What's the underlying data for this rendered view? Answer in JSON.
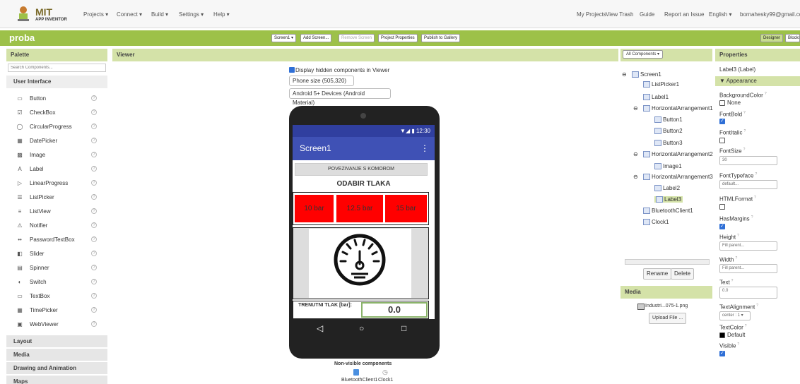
{
  "topnav": {
    "logo_main": "MIT",
    "logo_sub": "APP INVENTOR",
    "menus": [
      "Projects ▾",
      "Connect ▾",
      "Build ▾",
      "Settings ▾",
      "Help ▾"
    ],
    "right": [
      "My Projects",
      "View Trash",
      "Guide",
      "Report an Issue",
      "English ▾",
      "bornahesky99@gmail.com"
    ]
  },
  "projbar": {
    "project_name": "proba",
    "buttons": [
      "Screen1 ▾",
      "Add Screen...",
      "Remove Screen",
      "Project Properties",
      "Publish to Gallery"
    ],
    "designer": "Designer",
    "blocks": "Blocks"
  },
  "palette": {
    "title": "Palette",
    "search_placeholder": "Search Components...",
    "category_open": "User Interface",
    "items": [
      {
        "label": "Button",
        "icon": "button-icon"
      },
      {
        "label": "CheckBox",
        "icon": "checkbox-icon"
      },
      {
        "label": "CircularProgress",
        "icon": "circular-progress-icon"
      },
      {
        "label": "DatePicker",
        "icon": "datepicker-icon"
      },
      {
        "label": "Image",
        "icon": "image-icon"
      },
      {
        "label": "Label",
        "icon": "label-icon"
      },
      {
        "label": "LinearProgress",
        "icon": "linear-progress-icon"
      },
      {
        "label": "ListPicker",
        "icon": "listpicker-icon"
      },
      {
        "label": "ListView",
        "icon": "listview-icon"
      },
      {
        "label": "Notifier",
        "icon": "notifier-icon"
      },
      {
        "label": "PasswordTextBox",
        "icon": "password-icon"
      },
      {
        "label": "Slider",
        "icon": "slider-icon"
      },
      {
        "label": "Spinner",
        "icon": "spinner-icon"
      },
      {
        "label": "Switch",
        "icon": "switch-icon"
      },
      {
        "label": "TextBox",
        "icon": "textbox-icon"
      },
      {
        "label": "TimePicker",
        "icon": "timepicker-icon"
      },
      {
        "label": "WebViewer",
        "icon": "webviewer-icon"
      }
    ],
    "categories": [
      "Layout",
      "Media",
      "Drawing and Animation",
      "Maps"
    ]
  },
  "viewer": {
    "title": "Viewer",
    "hidden_label": "Display hidden components in Viewer",
    "size_select": "Phone size (505,320)",
    "theme_select": "Android 5+ Devices (Android Material)",
    "status_time": "12:30",
    "screen_title": "Screen1",
    "connect_btn": "POVEZIVANJE S KOMOROM",
    "heading": "ODABIR TLAKA",
    "pressure_buttons": [
      "10 bar",
      "12.5 bar",
      "15 bar"
    ],
    "current_label": "TRENUTNI TLAK [bar]:",
    "current_value": "0.0",
    "nonvisible_title": "Non-visible components",
    "nonvisible": [
      "BluetoothClient1",
      "Clock1"
    ]
  },
  "components": {
    "dropdown": "All Components ▾",
    "tree": [
      {
        "label": "Screen1",
        "level": 0,
        "toggle": "⊖"
      },
      {
        "label": "ListPicker1",
        "level": 1
      },
      {
        "label": "Label1",
        "level": 1
      },
      {
        "label": "HorizontalArrangement1",
        "level": 1,
        "toggle": "⊖"
      },
      {
        "label": "Button1",
        "level": 2
      },
      {
        "label": "Button2",
        "level": 2
      },
      {
        "label": "Button3",
        "level": 2
      },
      {
        "label": "HorizontalArrangement2",
        "level": 1,
        "toggle": "⊖"
      },
      {
        "label": "Image1",
        "level": 2
      },
      {
        "label": "HorizontalArrangement3",
        "level": 1,
        "toggle": "⊖"
      },
      {
        "label": "Label2",
        "level": 2
      },
      {
        "label": "Label3",
        "level": 2,
        "selected": true
      },
      {
        "label": "BluetoothClient1",
        "level": 1
      },
      {
        "label": "Clock1",
        "level": 1
      }
    ],
    "rename": "Rename",
    "delete": "Delete",
    "media_title": "Media",
    "media_file": "Industri...075-1.png",
    "upload": "Upload File ..."
  },
  "properties": {
    "title": "Properties",
    "component": "Label3 (Label)",
    "section": "▼ Appearance",
    "bgcolor_label": "BackgroundColor",
    "bgcolor_value": "None",
    "fontbold_label": "FontBold",
    "fontitalic_label": "FontItalic",
    "fontsize_label": "FontSize",
    "fontsize_value": "30",
    "typeface_label": "FontTypeface",
    "typeface_value": "default...",
    "htmlformat_label": "HTMLFormat",
    "hasmargins_label": "HasMargins",
    "height_label": "Height",
    "height_value": "Fill parent...",
    "width_label": "Width",
    "width_value": "Fill parent...",
    "text_label": "Text",
    "text_value": "0.0",
    "align_label": "TextAlignment",
    "align_value": "center : 1 ▾",
    "textcolor_label": "TextColor",
    "textcolor_value": "Default",
    "visible_label": "Visible",
    "help": "?"
  },
  "colors": {
    "accent_green": "#9dc149",
    "pressure_red": "#ff0000",
    "app_bar": "#3f51b5"
  }
}
